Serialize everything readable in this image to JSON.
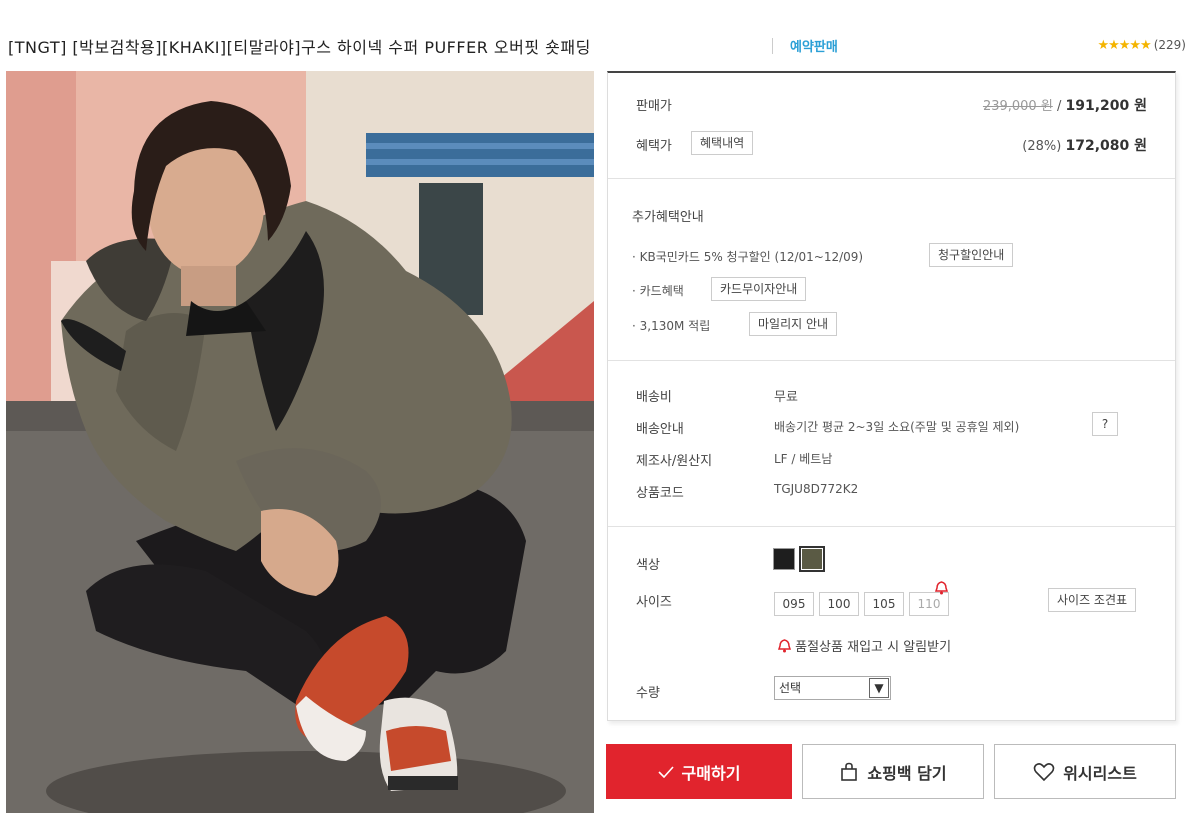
{
  "header": {
    "title": "[TNGT] [박보검착용][KHAKI][티말라야]구스 하이넥 수퍼 PUFFER 오버핏 숏패딩",
    "preorder_label": "예약판매",
    "rating_stars": "★★★★★",
    "review_count": "(229)"
  },
  "price": {
    "sale_label": "판매가",
    "original": "239,000 원",
    "separator": "/",
    "sale": "191,200 원",
    "benefit_label": "혜택가",
    "benefit_detail_button": "혜택내역",
    "discount_rate": "(28%)",
    "benefit_price": "172,080 원"
  },
  "benefits": {
    "heading": "추가혜택안내",
    "items": [
      {
        "text": "· KB국민카드 5% 청구할인 (12/01~12/09)",
        "button": "청구할인안내"
      },
      {
        "text": "· 카드혜택",
        "button": "카드무이자안내"
      },
      {
        "text": "· 3,130M 적립",
        "button": "마일리지 안내"
      }
    ]
  },
  "shipping": {
    "fee_label": "배송비",
    "fee_value": "무료",
    "info_label": "배송안내",
    "info_value": "배송기간 평균 2~3일 소요(주말 및 공휴일 제외)",
    "help_button": "?",
    "maker_label": "제조사/원산지",
    "maker_value": "LF / 베트남",
    "code_label": "상품코드",
    "code_value": "TGJU8D772K2"
  },
  "options": {
    "color_label": "색상",
    "colors": [
      "#1e1e1e",
      "#5a5a44"
    ],
    "size_label": "사이즈",
    "sizes": [
      "095",
      "100",
      "105",
      "110"
    ],
    "size_chart_button": "사이즈 조견표",
    "restock_alert": "품절상품 재입고 시 알림받기",
    "qty_label": "수량",
    "qty_selected": "선택"
  },
  "actions": {
    "buy": "구매하기",
    "bag": "쇼핑백 담기",
    "wish": "위시리스트"
  },
  "colors": {
    "accent_red": "#e1242d",
    "preorder_blue": "#2a9fd6",
    "star": "#f4b400"
  }
}
